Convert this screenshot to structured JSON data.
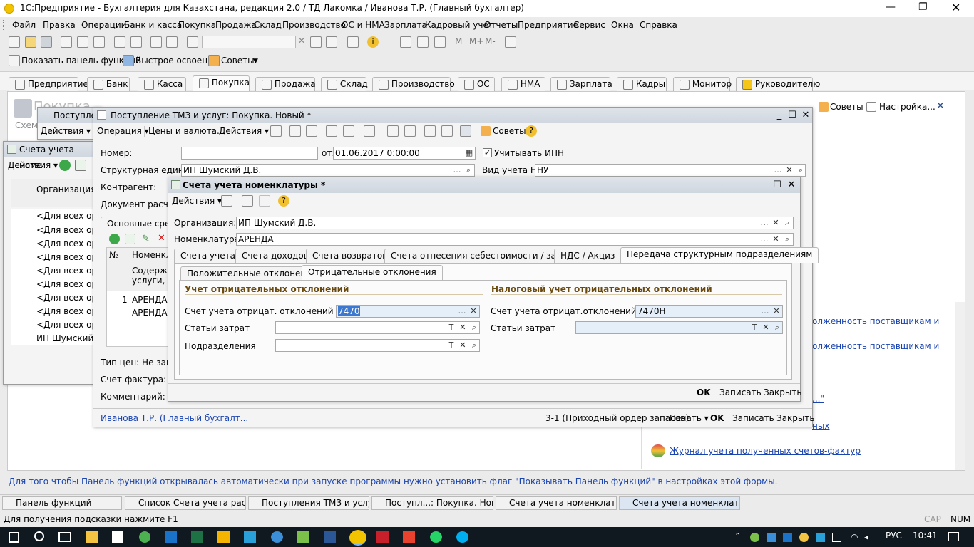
{
  "app": {
    "title": "1С:Предприятие - Бухгалтерия для Казахстана, редакция 2.0 / ТД Лакомка / Иванова Т.Р. (Главный бухгалтер)"
  },
  "menu": [
    "Файл",
    "Правка",
    "Операции",
    "Банк и касса",
    "Покупка",
    "Продажа",
    "Склад",
    "Производство",
    "ОС и НМА",
    "Зарплата",
    "Кадровый учет",
    "Отчеты",
    "Предприятие",
    "Сервис",
    "Окна",
    "Справка"
  ],
  "toolbar2": {
    "show_panel": "Показать панель функций",
    "quick": "Быстрое освоение",
    "tips": "Советы"
  },
  "sections": [
    "Предприятие",
    "Банк",
    "Касса",
    "Покупка",
    "Продажа",
    "Склад",
    "Производство",
    "ОС",
    "НМА",
    "Зарплата",
    "Кадры",
    "Монитор",
    "Руководителю"
  ],
  "panel": {
    "title": "Покупка",
    "schema": "Схем",
    "tips": "Советы",
    "settings": "Настройка...",
    "links": [
      "олженность поставщикам и",
      "олженность поставщикам и",
      "...\"",
      "ных",
      "Журнал учета полученных счетов-фактур"
    ],
    "hint": "Для того чтобы Панель функций открывалась автоматически при запуске программы нужно установить флаг \"Показывать Панель функций\" в настройках этой формы."
  },
  "list_win": {
    "title": "Счета учета номе",
    "actions": "Действия",
    "org_col": "Организация",
    "rows": [
      "<Для всех орга",
      "<Для всех орга",
      "<Для всех орга",
      "<Для всех орга",
      "<Для всех орга",
      "<Для всех орга",
      "<Для всех орга",
      "<Для всех орга",
      "<Для всех орга",
      "ИП Шумский Д."
    ]
  },
  "behind_win": {
    "title": "Поступле",
    "actions": "Действия"
  },
  "doc": {
    "title": "Поступление ТМЗ и услуг: Покупка. Новый *",
    "toolbar": {
      "operation": "Операция",
      "prices": "Цены и валюта...",
      "actions": "Действия",
      "tips": "Советы"
    },
    "number_label": "Номер:",
    "number": "",
    "date_label": "от:",
    "date": "01.06.2017  0:00:00",
    "ipn": "Учитывать ИПН",
    "unit_label": "Структурная единица:",
    "unit": "ИП Шумский Д.В.",
    "nu_label": "Вид учета НУ:",
    "nu": "НУ",
    "contr_label": "Контрагент:",
    "docset_label": "Документ расчет",
    "tab_main": "Основные средс",
    "table": {
      "no": "№",
      "nom": "Номенкла",
      "content": "Содержан",
      "services": "услуги, до",
      "row_no": "1",
      "row1": "АРЕНДА",
      "row2": "АРЕНДА"
    },
    "price_type": "Тип цен: Не запол",
    "invoice_label": "Счет-фактура:",
    "comment_label": "Комментарий:",
    "footer": {
      "user": "Иванова Т.Р. (Главный бухгалт...",
      "order": "3-1 (Приходный ордер запасов)",
      "print": "Печать",
      "ok": "OK",
      "save": "Записать",
      "close": "Закрыть"
    }
  },
  "accounts": {
    "title": "Счета учета номенклатуры *",
    "actions": "Действия",
    "org_label": "Организация:",
    "org": "ИП Шумский Д.В.",
    "nom_label": "Номенклатура:",
    "nom": "АРЕНДА",
    "tabs": [
      "Счета учета",
      "Счета доходов",
      "Счета возвратов",
      "Счета отнесения себестоимости / затрат",
      "НДС / Акциз",
      "Передача структурным подразделениям"
    ],
    "subtabs": [
      "Положительные отклонения",
      "Отрицательные отклонения"
    ],
    "bu_group": "Учет отрицательных отклонений",
    "nu_group": "Налоговый учет отрицательных отклонений",
    "bu_acc_label": "Счет учета отрицат. отклонений (БУ):",
    "bu_acc": "7470",
    "nu_acc_label": "Счет учета отрицат.отклонений (НУ):",
    "nu_acc": "7470Н",
    "cost_label": "Статьи затрат",
    "cost_bu": "",
    "cost_nu": "",
    "dept_label": "Подразделения",
    "dept": "",
    "ok": "OK",
    "save": "Записать",
    "close": "Закрыть"
  },
  "taskbar": [
    "Панель функций",
    "Список Счета учета расчет...",
    "Поступления ТМЗ и услуг",
    "Поступл...: Покупка. Новый *",
    "Счета учета номенклатуры",
    "Счета учета номенклатуры *"
  ],
  "status": {
    "hint": "Для получения подсказки нажмите F1",
    "cap": "CAP",
    "num": "NUM"
  },
  "win_taskbar": {
    "lang": "РУС",
    "time": "10:41"
  },
  "colors": {
    "accent": "#cfd6de",
    "link": "#1a44b0",
    "taskbar": "#101820"
  }
}
